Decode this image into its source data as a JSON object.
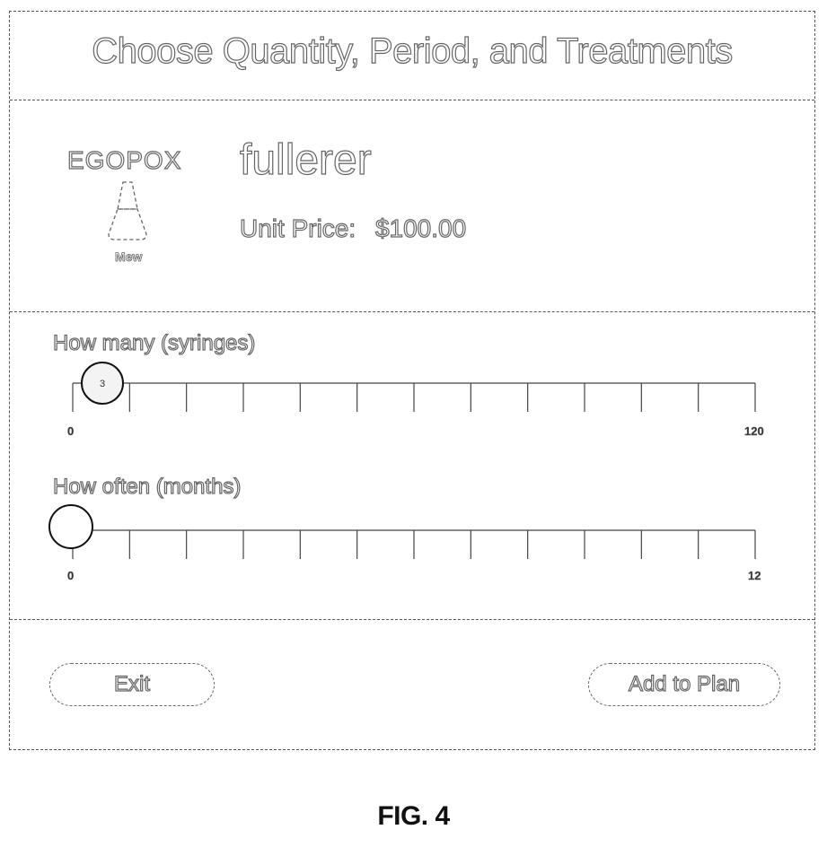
{
  "dialog": {
    "title": "Choose Quantity, Period, and Treatments",
    "logo": {
      "text": "EGOPOX",
      "caption": "Mew",
      "icon": "dropper-icon"
    },
    "product": {
      "name": "fullerer",
      "unit_price_label": "Unit Price:",
      "unit_price_value": "$100.00"
    },
    "quantity_slider": {
      "label": "How many (syringes)",
      "min_label": "0",
      "max_label": "120",
      "min": 0,
      "max": 120,
      "value": 3,
      "value_display": "3"
    },
    "period_slider": {
      "label": "How often (months)",
      "min_label": "0",
      "max_label": "12",
      "min": 0,
      "max": 12,
      "value": 0
    },
    "buttons": {
      "exit_label": "Exit",
      "add_label": "Add to Plan"
    }
  },
  "figure_caption": "FIG. 4"
}
